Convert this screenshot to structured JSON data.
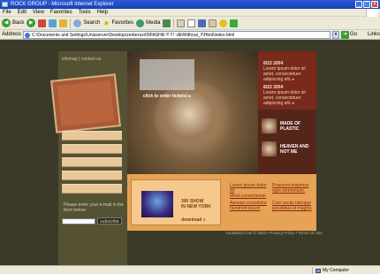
{
  "window": {
    "title": "ROCK GROUP - Microsoft Internet Explorer",
    "min": "_",
    "max": "□",
    "close": "×"
  },
  "menu": [
    "File",
    "Edit",
    "View",
    "Favorites",
    "Tools",
    "Help"
  ],
  "toolbar": {
    "back_label": "Back",
    "search_label": "Search",
    "favorites_label": "Favorites",
    "media_label": "Media"
  },
  "addressbar": {
    "label": "Address",
    "url": "C:\\Documents and Settings\\Unisserver\\Desktop\\zerberus\\09FASHA !!! !!! -db\\Without_!!\\Html\\index.html",
    "go_label": "Go",
    "links_label": "Links"
  },
  "site": {
    "nav": "sitemap | contact us",
    "hero_link": "click to order tickets! ▸",
    "news": [
      {
        "date": "8/22 2004",
        "text": "Lorem ipsum dolor sit amet, consectetuer adipiscing elit. ▸"
      },
      {
        "date": "8/22 2004",
        "text": "Lorem ipsum dolor sit amet, consectetuer adipiscing elit. ▸"
      }
    ],
    "thumbs": [
      {
        "label": "MADE OF PLASTIC"
      },
      {
        "label": "HEAVEN AND NOT ME"
      }
    ],
    "promo": {
      "line1": "300 SHOW",
      "line2": "IN NEW YORK",
      "download": "download »"
    },
    "links": [
      "Lorem ipsum dolor sit amet.consectetuer",
      "Aenean consetetur hendrerit ipsum",
      "Praesent maximus eget elementum.",
      "Cum sociis natoque penatibus et magnis"
    ],
    "subscribe_text": "Please enter your e-mail in the form below:",
    "subscribe_button": "subscribe",
    "footer": "YourBand.Com © 2004 • Privacy Policy • Terms Of Use"
  },
  "status": {
    "text": "",
    "zone": "My Computer"
  }
}
